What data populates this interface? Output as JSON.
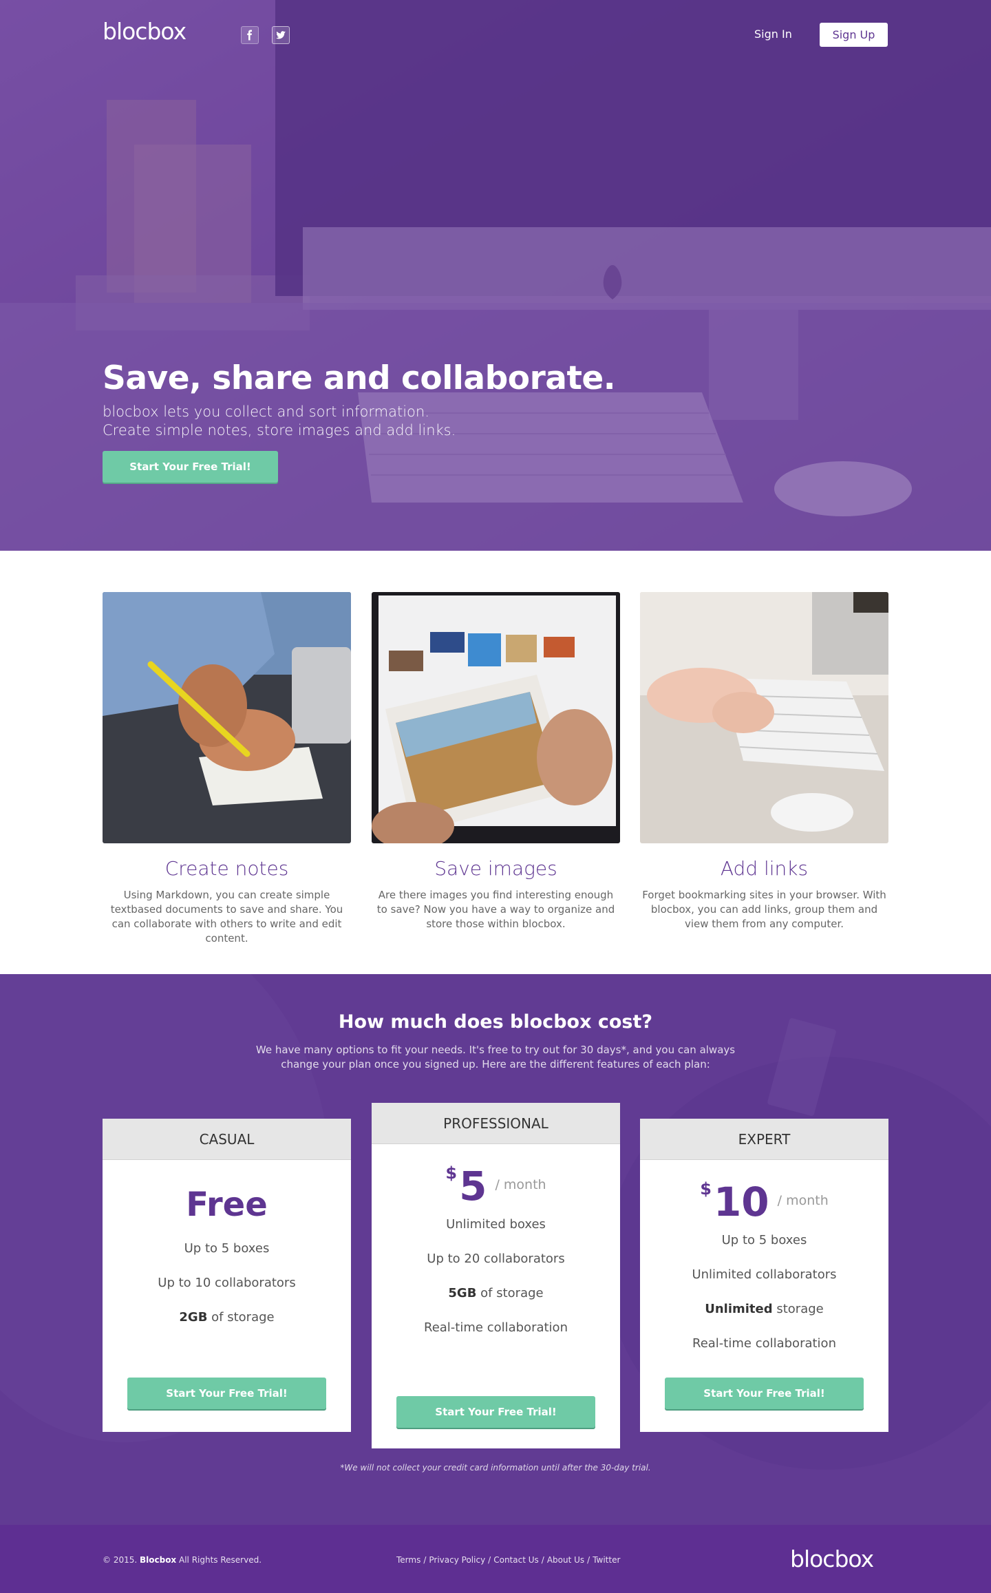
{
  "header": {
    "logo": "blocbox",
    "social": [
      {
        "name": "facebook",
        "icon": "facebook-icon"
      },
      {
        "name": "twitter",
        "icon": "twitter-icon"
      }
    ],
    "signin_label": "Sign In",
    "signup_label": "Sign Up"
  },
  "hero": {
    "title": "Save, share and collaborate.",
    "subtitle_line1": "blocbox lets you collect and sort information.",
    "subtitle_line2": "Create simple notes, store images and add links.",
    "cta": "Start Your Free Trial!"
  },
  "features": [
    {
      "title": "Create notes",
      "text": "Using Markdown, you can create simple textbased documents to save and share. You can collaborate with others to write and edit content."
    },
    {
      "title": "Save images",
      "text": "Are there images you find interesting enough to save? Now you have a way to organize and store those within blocbox."
    },
    {
      "title": "Add links",
      "text": "Forget bookmarking sites in your browser. With blocbox, you can add links, group them and view them from any computer."
    }
  ],
  "pricing": {
    "title": "How much does blocbox cost?",
    "intro": "We have many options to fit your needs. It's free to try out for 30 days*, and you can always change your plan once you signed up. Here are the different features of each plan:",
    "plans": [
      {
        "name": "CASUAL",
        "price": "Free",
        "features": [
          {
            "pre": "",
            "bold": "",
            "post": "Up to 5 boxes"
          },
          {
            "pre": "",
            "bold": "",
            "post": "Up to 10 collaborators"
          },
          {
            "pre": "",
            "bold": "2GB",
            "post": " of storage"
          }
        ],
        "cta": "Start Your Free Trial!"
      },
      {
        "name": "PROFESSIONAL",
        "currency": "$",
        "price": "5",
        "period": "/ month",
        "features": [
          {
            "pre": "",
            "bold": "",
            "post": "Unlimited boxes"
          },
          {
            "pre": "",
            "bold": "",
            "post": "Up to 20 collaborators"
          },
          {
            "pre": "",
            "bold": "5GB",
            "post": " of storage"
          },
          {
            "pre": "",
            "bold": "",
            "post": "Real-time collaboration"
          }
        ],
        "cta": "Start Your Free Trial!"
      },
      {
        "name": "EXPERT",
        "currency": "$",
        "price": "10",
        "period": "/ month",
        "features": [
          {
            "pre": "",
            "bold": "",
            "post": "Up to 5 boxes"
          },
          {
            "pre": "",
            "bold": "",
            "post": "Unlimited collaborators"
          },
          {
            "pre": "",
            "bold": "Unlimited",
            "post": " storage"
          },
          {
            "pre": "",
            "bold": "",
            "post": "Real-time collaboration"
          }
        ],
        "cta": "Start Your Free Trial!"
      }
    ],
    "note": "*We will not collect your credit card information until after the 30-day trial."
  },
  "footer": {
    "copyright_pre": "© 2015. ",
    "copyright_brand": "Blocbox",
    "copyright_post": "  All Rights Reserved.",
    "links": [
      "Terms",
      "Privacy Policy",
      "Contact Us",
      "About Us",
      "Twitter"
    ],
    "logo": "blocbox"
  },
  "colors": {
    "brand_purple": "#5e3591",
    "accent_green": "#6fcaa6",
    "footer_purple": "#5e2f92"
  }
}
